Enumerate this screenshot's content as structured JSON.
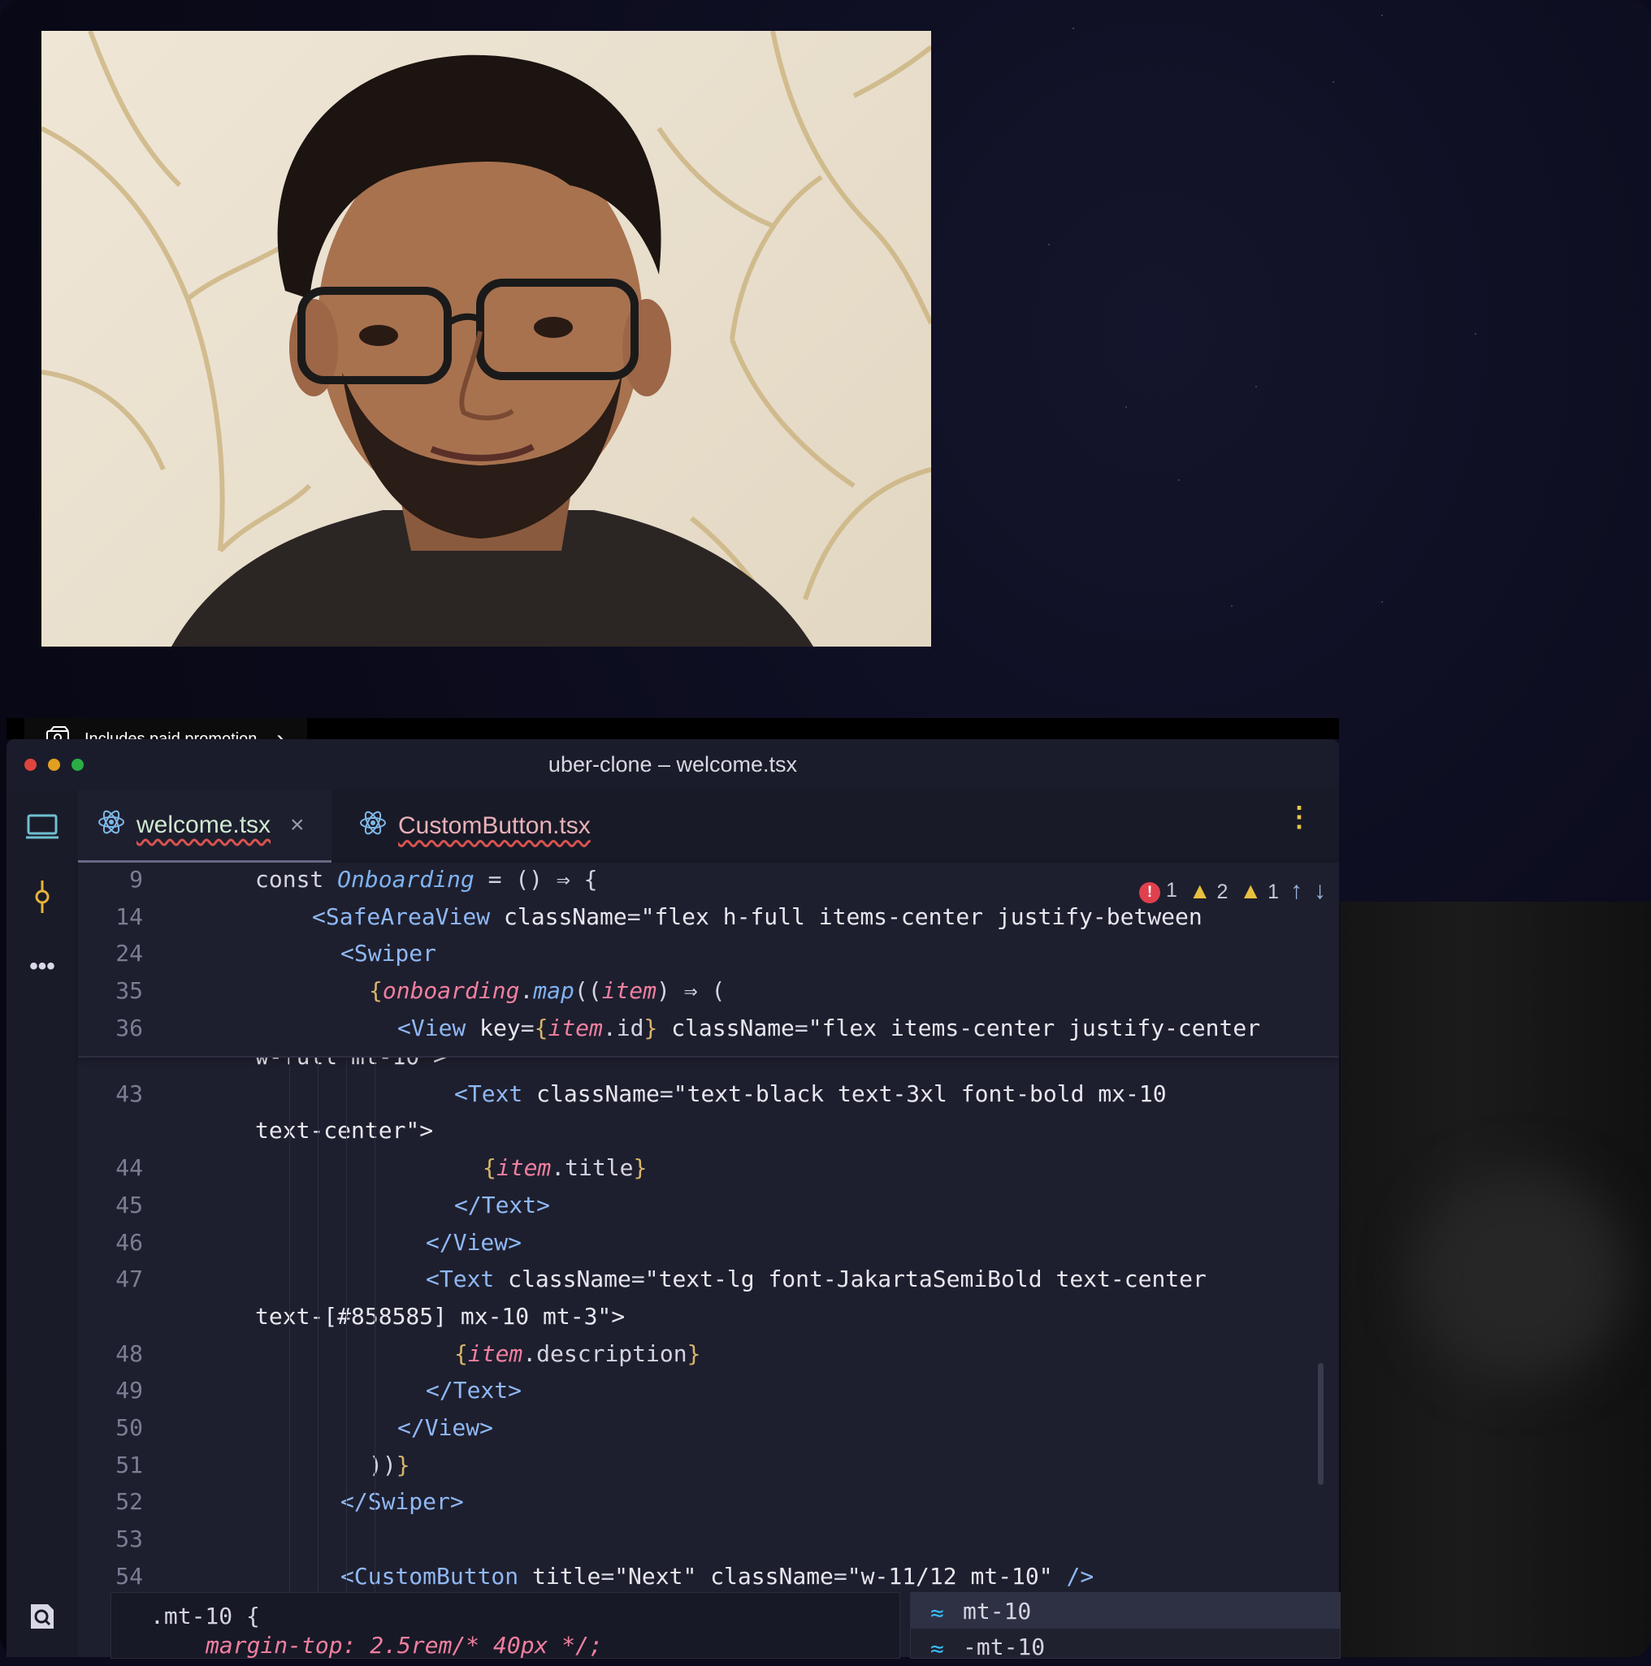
{
  "promo": {
    "label": "Includes paid promotion",
    "chevron": "›",
    "icon": "paid-promotion-icon"
  },
  "window": {
    "title": "uber-clone – welcome.tsx"
  },
  "tabs": [
    {
      "label": "welcome.tsx",
      "close": "×",
      "icon": "react-icon",
      "active": true
    },
    {
      "label": "CustomButton.tsx",
      "icon": "react-icon",
      "active": false
    }
  ],
  "activity_icons": [
    "monitor-icon",
    "commit-icon",
    "more-icon",
    "search-file-icon",
    "terminal-icon"
  ],
  "more_menu": "⋮",
  "issues": {
    "errors": "1",
    "warnings": "2",
    "weak_warnings": "1",
    "up": "↑",
    "down": "↓"
  },
  "sticky_lines": [
    {
      "num": "9",
      "indent": 2,
      "parts": [
        [
          "k",
          "const "
        ],
        [
          "fn",
          "Onboarding"
        ],
        [
          "k",
          " = () ⇒ {"
        ]
      ]
    },
    {
      "num": "14",
      "indent": 4,
      "parts": [
        [
          "tag",
          "<SafeAreaView "
        ],
        [
          "attr",
          "className"
        ],
        [
          "k",
          "="
        ],
        [
          "str",
          "\"flex h-full items-center justify-between"
        ]
      ]
    },
    {
      "num": "24",
      "indent": 5,
      "parts": [
        [
          "tag",
          "<Swiper"
        ]
      ]
    },
    {
      "num": "35",
      "indent": 6,
      "parts": [
        [
          "br",
          "{"
        ],
        [
          "var",
          "onboarding"
        ],
        [
          "k",
          "."
        ],
        [
          "fn",
          "map"
        ],
        [
          "k",
          "(("
        ],
        [
          "var",
          "item"
        ],
        [
          "k",
          ") ⇒ ("
        ]
      ]
    },
    {
      "num": "36",
      "indent": 7,
      "parts": [
        [
          "tag",
          "<View "
        ],
        [
          "attr",
          "key"
        ],
        [
          "k",
          "="
        ],
        [
          "br",
          "{"
        ],
        [
          "var",
          "item"
        ],
        [
          "k",
          ".id"
        ],
        [
          "br",
          "}"
        ],
        [
          "k",
          " "
        ],
        [
          "attr",
          "className"
        ],
        [
          "k",
          "="
        ],
        [
          "str",
          "\"flex items-center justify-center"
        ]
      ]
    }
  ],
  "code_lines": [
    {
      "num": "",
      "indent": 2,
      "parts": [
        [
          "str",
          "w-full mt-10\">"
        ]
      ]
    },
    {
      "num": "43",
      "indent": 9,
      "parts": [
        [
          "tag",
          "<Text "
        ],
        [
          "attr",
          "className"
        ],
        [
          "k",
          "="
        ],
        [
          "str",
          "\"text-black text-3xl font-bold mx-10"
        ]
      ]
    },
    {
      "num": "",
      "indent": 2,
      "parts": [
        [
          "str",
          "text-center\">"
        ]
      ]
    },
    {
      "num": "44",
      "indent": 10,
      "parts": [
        [
          "br",
          "{"
        ],
        [
          "var",
          "item"
        ],
        [
          "k",
          ".title"
        ],
        [
          "br",
          "}"
        ]
      ]
    },
    {
      "num": "45",
      "indent": 9,
      "parts": [
        [
          "tag",
          "</Text>"
        ]
      ]
    },
    {
      "num": "46",
      "indent": 8,
      "parts": [
        [
          "tag",
          "</View>"
        ]
      ]
    },
    {
      "num": "47",
      "indent": 8,
      "parts": [
        [
          "tag",
          "<Text "
        ],
        [
          "attr",
          "className"
        ],
        [
          "k",
          "="
        ],
        [
          "str",
          "\"text-lg font-JakartaSemiBold text-center"
        ]
      ]
    },
    {
      "num": "",
      "indent": 2,
      "parts": [
        [
          "str",
          "text-[#858585] mx-10 mt-3\">"
        ]
      ]
    },
    {
      "num": "48",
      "indent": 9,
      "parts": [
        [
          "br",
          "{"
        ],
        [
          "var",
          "item"
        ],
        [
          "k",
          ".description"
        ],
        [
          "br",
          "}"
        ]
      ]
    },
    {
      "num": "49",
      "indent": 8,
      "parts": [
        [
          "tag",
          "</Text>"
        ]
      ]
    },
    {
      "num": "50",
      "indent": 7,
      "parts": [
        [
          "tag",
          "</View>"
        ]
      ]
    },
    {
      "num": "51",
      "indent": 6,
      "parts": [
        [
          "k",
          "))"
        ],
        [
          "br",
          "}"
        ]
      ]
    },
    {
      "num": "52",
      "indent": 5,
      "parts": [
        [
          "tag",
          "</Swiper>"
        ]
      ]
    },
    {
      "num": "53",
      "indent": 0,
      "parts": []
    },
    {
      "num": "54",
      "indent": 5,
      "parts": [
        [
          "tag",
          "<CustomButton "
        ],
        [
          "attr",
          "title"
        ],
        [
          "k",
          "="
        ],
        [
          "str",
          "\"Next\" "
        ],
        [
          "attr",
          "className"
        ],
        [
          "k",
          "="
        ],
        [
          "str",
          "\"w-11/12 mt-10\" "
        ],
        [
          "tag",
          "/>"
        ]
      ]
    }
  ],
  "css_popup": {
    "selector": ".mt-10 {",
    "decl": "margin-top: 2.5rem/* 40px */;"
  },
  "completion": {
    "icon": "tailwind-icon",
    "items": [
      "mt-10",
      "-mt-10"
    ]
  },
  "colors": {
    "accent_blue": "#3b82f6",
    "error": "#e0404d",
    "warning": "#e8c040"
  }
}
